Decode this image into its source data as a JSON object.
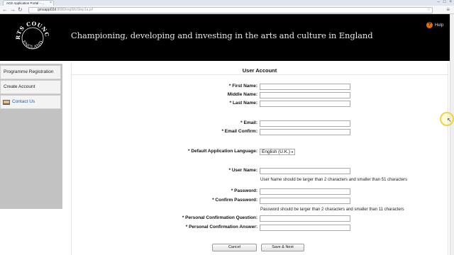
{
  "browser": {
    "tab_title": "ACE Application Portal - ...",
    "url_host": "gmsapp02d",
    "url_path": ":8080/regWizStep1a.jsf",
    "window_controls": [
      "–",
      "□",
      "×"
    ]
  },
  "banner": {
    "logo_text": "ARTS COUNCIL ENGLAND",
    "tagline": "Championing, developing and investing in the arts and culture in England",
    "help_label": "Help"
  },
  "sidebar": {
    "items": [
      {
        "label": "Programme Registration"
      },
      {
        "label": "Create Account"
      },
      {
        "label": "Contact Us"
      }
    ]
  },
  "form": {
    "title": "User Account",
    "first_name_label": "* First Name:",
    "middle_name_label": "Middle Name:",
    "last_name_label": "* Last Name:",
    "email_label": "* Email:",
    "email_confirm_label": "* Email Confirm:",
    "language_label": "* Default Application Language:",
    "language_value": "English (U.K.)",
    "user_name_label": "* User Name:",
    "user_name_hint": "User Name should be larger than 2 characters and smaller than 51 characters",
    "password_label": "* Password:",
    "confirm_password_label": "* Confirm Password:",
    "password_hint": "Password should be larger than 2 characters and smaller than 11 characters",
    "question_label": "* Personal Confirmation Question:",
    "answer_label": "* Personal Confirmation Answer:",
    "first_name_value": "",
    "middle_name_value": "",
    "last_name_value": "",
    "email_value": "",
    "email_confirm_value": "",
    "user_name_value": "",
    "password_value": "",
    "confirm_password_value": "",
    "question_value": "",
    "answer_value": ""
  },
  "buttons": {
    "cancel": "Cancel",
    "save_next": "Save & Next"
  },
  "colors": {
    "banner_bg": "#000000",
    "help_icon": "#e36c0a",
    "contact_link": "#1f5aa6"
  }
}
